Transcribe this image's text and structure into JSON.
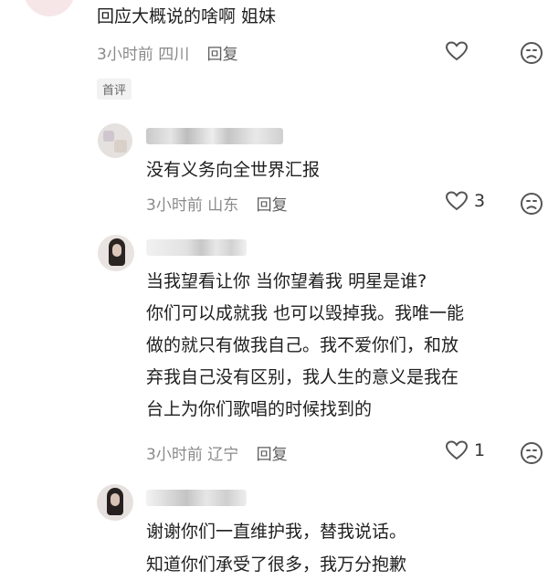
{
  "comments": [
    {
      "text_lines": [
        "回应大概说的啥啊 姐妹"
      ],
      "time": "3小时前",
      "location": "四川",
      "reply_label": "回复",
      "likes": "",
      "tag": "首评"
    },
    {
      "text_lines": [
        "没有义务向全世界汇报"
      ],
      "time": "3小时前",
      "location": "山东",
      "reply_label": "回复",
      "likes": "3"
    },
    {
      "text_lines": [
        "当我望看让你 当你望着我 明星是谁?",
        "你们可以成就我 也可以毁掉我。我唯一能",
        "做的就只有做我自己。我不爱你们，和放",
        "弃我自己没有区别，我人生的意义是我在",
        "台上为你们歌唱的时候找到的"
      ],
      "time": "3小时前",
      "location": "辽宁",
      "reply_label": "回复",
      "likes": "1"
    },
    {
      "text_lines": [
        "谢谢你们一直维护我，替我说话。",
        "知道你们承受了很多，我万分抱歉"
      ]
    }
  ],
  "icons": {
    "like": "heart-outline-icon",
    "dislike": "sad-face-icon"
  },
  "colors": {
    "text": "#1f1f1f",
    "meta": "#8a8a8a",
    "icon": "#555555"
  }
}
